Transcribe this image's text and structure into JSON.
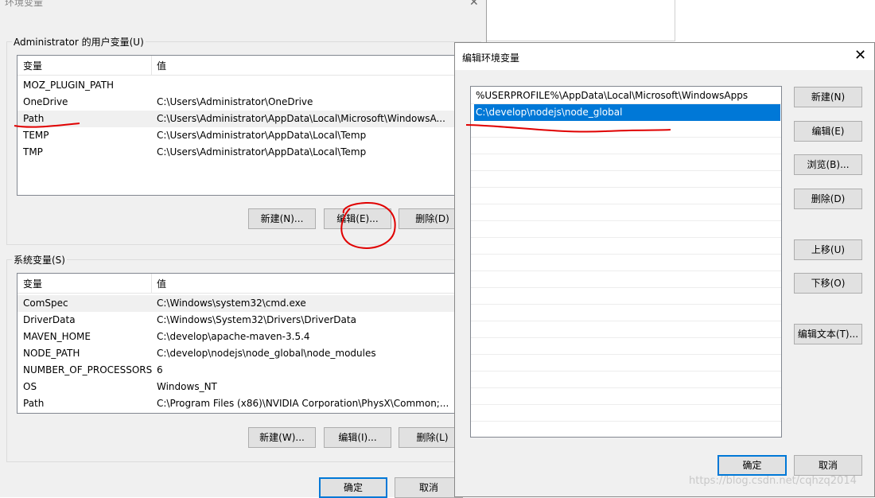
{
  "env_window": {
    "title": "环境变量",
    "user_group_label": "Administrator 的用户变量(U)",
    "system_group_label": "系统变量(S)",
    "col_variable": "变量",
    "col_value": "值",
    "user_vars": [
      {
        "name": "MOZ_PLUGIN_PATH",
        "value": ""
      },
      {
        "name": "OneDrive",
        "value": "C:\\Users\\Administrator\\OneDrive"
      },
      {
        "name": "Path",
        "value": "C:\\Users\\Administrator\\AppData\\Local\\Microsoft\\WindowsA..."
      },
      {
        "name": "TEMP",
        "value": "C:\\Users\\Administrator\\AppData\\Local\\Temp"
      },
      {
        "name": "TMP",
        "value": "C:\\Users\\Administrator\\AppData\\Local\\Temp"
      }
    ],
    "user_buttons": {
      "new": "新建(N)...",
      "edit": "编辑(E)...",
      "delete": "删除(D)"
    },
    "system_vars": [
      {
        "name": "ComSpec",
        "value": "C:\\Windows\\system32\\cmd.exe"
      },
      {
        "name": "DriverData",
        "value": "C:\\Windows\\System32\\Drivers\\DriverData"
      },
      {
        "name": "MAVEN_HOME",
        "value": "C:\\develop\\apache-maven-3.5.4"
      },
      {
        "name": "NODE_PATH",
        "value": "C:\\develop\\nodejs\\node_global\\node_modules"
      },
      {
        "name": "NUMBER_OF_PROCESSORS",
        "value": "6"
      },
      {
        "name": "OS",
        "value": "Windows_NT"
      },
      {
        "name": "Path",
        "value": "C:\\Program Files (x86)\\NVIDIA Corporation\\PhysX\\Common;..."
      }
    ],
    "system_buttons": {
      "new": "新建(W)...",
      "edit": "编辑(I)...",
      "delete": "删除(L)"
    },
    "ok": "确定",
    "cancel": "取消"
  },
  "edit_dialog": {
    "title": "编辑环境变量",
    "close_icon": "close-icon",
    "entries": [
      "%USERPROFILE%\\AppData\\Local\\Microsoft\\WindowsApps",
      "C:\\develop\\nodejs\\node_global"
    ],
    "buttons": {
      "new": "新建(N)",
      "edit": "编辑(E)",
      "browse": "浏览(B)...",
      "delete": "删除(D)",
      "move_up": "上移(U)",
      "move_down": "下移(O)",
      "edit_text": "编辑文本(T)...",
      "ok": "确定",
      "cancel": "取消"
    }
  },
  "watermark": "https://blog.csdn.net/cqhzq2014",
  "colors": {
    "selection": "#0078d7",
    "annotation": "#e00000"
  }
}
